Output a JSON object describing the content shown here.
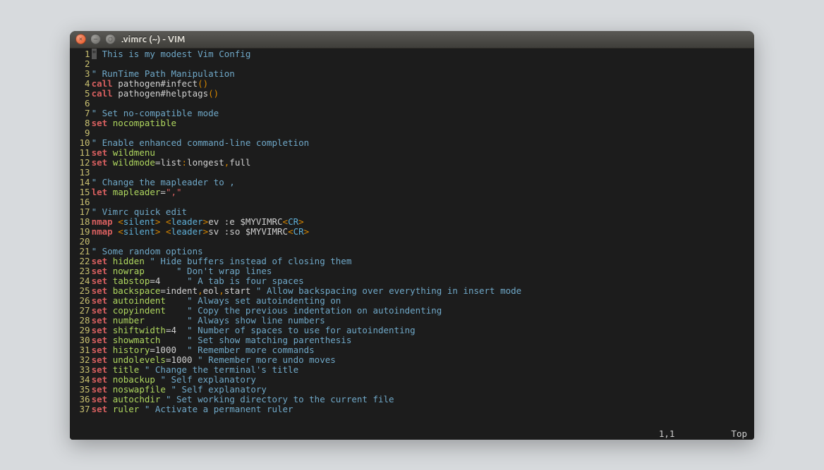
{
  "window": {
    "title": ".vimrc (~) - VIM"
  },
  "status": {
    "pos": "1,1",
    "scroll": "Top"
  },
  "lines": [
    {
      "n": 1,
      "seg": [
        {
          "t": "\""
        },
        {
          "t": " This is my modest Vim Config",
          "c": "c-comment"
        }
      ],
      "cursor_first": true
    },
    {
      "n": 2,
      "seg": []
    },
    {
      "n": 3,
      "seg": [
        {
          "t": "\" RunTime Path Manipulation",
          "c": "c-comment"
        }
      ]
    },
    {
      "n": 4,
      "seg": [
        {
          "t": "call",
          "c": "c-call"
        },
        {
          "t": " "
        },
        {
          "t": "pathogen#infect",
          "c": "c-func"
        },
        {
          "t": "()",
          "c": "c-paren"
        }
      ]
    },
    {
      "n": 5,
      "seg": [
        {
          "t": "call",
          "c": "c-call"
        },
        {
          "t": " "
        },
        {
          "t": "pathogen#helptags",
          "c": "c-func"
        },
        {
          "t": "()",
          "c": "c-paren"
        }
      ]
    },
    {
      "n": 6,
      "seg": []
    },
    {
      "n": 7,
      "seg": [
        {
          "t": "\" Set no-compatible mode",
          "c": "c-comment"
        }
      ]
    },
    {
      "n": 8,
      "seg": [
        {
          "t": "set",
          "c": "c-set"
        },
        {
          "t": " "
        },
        {
          "t": "nocompatible",
          "c": "c-opt"
        }
      ]
    },
    {
      "n": 9,
      "seg": []
    },
    {
      "n": 10,
      "seg": [
        {
          "t": "\" Enable enhanced command-line completion",
          "c": "c-comment"
        }
      ]
    },
    {
      "n": 11,
      "seg": [
        {
          "t": "set",
          "c": "c-set"
        },
        {
          "t": " "
        },
        {
          "t": "wildmenu",
          "c": "c-opt"
        }
      ]
    },
    {
      "n": 12,
      "seg": [
        {
          "t": "set",
          "c": "c-set"
        },
        {
          "t": " "
        },
        {
          "t": "wildmode",
          "c": "c-opt"
        },
        {
          "t": "="
        },
        {
          "t": "list"
        },
        {
          "t": ":",
          "c": "c-punct"
        },
        {
          "t": "longest"
        },
        {
          "t": ",",
          "c": "c-punct"
        },
        {
          "t": "full"
        }
      ]
    },
    {
      "n": 13,
      "seg": []
    },
    {
      "n": 14,
      "seg": [
        {
          "t": "\" Change the mapleader to ,",
          "c": "c-comment"
        }
      ]
    },
    {
      "n": 15,
      "seg": [
        {
          "t": "let",
          "c": "c-let"
        },
        {
          "t": " "
        },
        {
          "t": "mapleader",
          "c": "c-opt"
        },
        {
          "t": "="
        },
        {
          "t": "\",\"",
          "c": "c-str"
        }
      ]
    },
    {
      "n": 16,
      "seg": []
    },
    {
      "n": 17,
      "seg": [
        {
          "t": "\" Vimrc quick edit",
          "c": "c-comment"
        }
      ]
    },
    {
      "n": 18,
      "seg": [
        {
          "t": "nmap",
          "c": "c-nmap"
        },
        {
          "t": " "
        },
        {
          "t": "<",
          "c": "c-angle"
        },
        {
          "t": "silent",
          "c": "c-special"
        },
        {
          "t": ">",
          "c": "c-angle"
        },
        {
          "t": " "
        },
        {
          "t": "<",
          "c": "c-angle"
        },
        {
          "t": "leader",
          "c": "c-special"
        },
        {
          "t": ">",
          "c": "c-angle"
        },
        {
          "t": "ev :e $MYVIMRC"
        },
        {
          "t": "<",
          "c": "c-angle"
        },
        {
          "t": "CR",
          "c": "c-special"
        },
        {
          "t": ">",
          "c": "c-angle"
        }
      ]
    },
    {
      "n": 19,
      "seg": [
        {
          "t": "nmap",
          "c": "c-nmap"
        },
        {
          "t": " "
        },
        {
          "t": "<",
          "c": "c-angle"
        },
        {
          "t": "silent",
          "c": "c-special"
        },
        {
          "t": ">",
          "c": "c-angle"
        },
        {
          "t": " "
        },
        {
          "t": "<",
          "c": "c-angle"
        },
        {
          "t": "leader",
          "c": "c-special"
        },
        {
          "t": ">",
          "c": "c-angle"
        },
        {
          "t": "sv :so $MYVIMRC"
        },
        {
          "t": "<",
          "c": "c-angle"
        },
        {
          "t": "CR",
          "c": "c-special"
        },
        {
          "t": ">",
          "c": "c-angle"
        }
      ]
    },
    {
      "n": 20,
      "seg": []
    },
    {
      "n": 21,
      "seg": [
        {
          "t": "\" Some random options",
          "c": "c-comment"
        }
      ]
    },
    {
      "n": 22,
      "seg": [
        {
          "t": "set",
          "c": "c-set"
        },
        {
          "t": " "
        },
        {
          "t": "hidden",
          "c": "c-opt"
        },
        {
          "t": " "
        },
        {
          "t": "\" Hide buffers instead of closing them",
          "c": "c-comment"
        }
      ]
    },
    {
      "n": 23,
      "seg": [
        {
          "t": "set",
          "c": "c-set"
        },
        {
          "t": " "
        },
        {
          "t": "nowrap",
          "c": "c-opt"
        },
        {
          "t": "      "
        },
        {
          "t": "\" Don't wrap lines",
          "c": "c-comment"
        }
      ]
    },
    {
      "n": 24,
      "seg": [
        {
          "t": "set",
          "c": "c-set"
        },
        {
          "t": " "
        },
        {
          "t": "tabstop",
          "c": "c-opt"
        },
        {
          "t": "=4     "
        },
        {
          "t": "\" A tab is four spaces",
          "c": "c-comment"
        }
      ]
    },
    {
      "n": 25,
      "seg": [
        {
          "t": "set",
          "c": "c-set"
        },
        {
          "t": " "
        },
        {
          "t": "backspace",
          "c": "c-opt"
        },
        {
          "t": "="
        },
        {
          "t": "indent"
        },
        {
          "t": ",",
          "c": "c-punct"
        },
        {
          "t": "eol"
        },
        {
          "t": ",",
          "c": "c-punct"
        },
        {
          "t": "start"
        },
        {
          "t": " "
        },
        {
          "t": "\" Allow backspacing over everything in insert mode",
          "c": "c-comment"
        }
      ]
    },
    {
      "n": 26,
      "seg": [
        {
          "t": "set",
          "c": "c-set"
        },
        {
          "t": " "
        },
        {
          "t": "autoindent",
          "c": "c-opt"
        },
        {
          "t": "    "
        },
        {
          "t": "\" Always set autoindenting on",
          "c": "c-comment"
        }
      ]
    },
    {
      "n": 27,
      "seg": [
        {
          "t": "set",
          "c": "c-set"
        },
        {
          "t": " "
        },
        {
          "t": "copyindent",
          "c": "c-opt"
        },
        {
          "t": "    "
        },
        {
          "t": "\" Copy the previous indentation on autoindenting",
          "c": "c-comment"
        }
      ]
    },
    {
      "n": 28,
      "seg": [
        {
          "t": "set",
          "c": "c-set"
        },
        {
          "t": " "
        },
        {
          "t": "number",
          "c": "c-opt"
        },
        {
          "t": "        "
        },
        {
          "t": "\" Always show line numbers",
          "c": "c-comment"
        }
      ]
    },
    {
      "n": 29,
      "seg": [
        {
          "t": "set",
          "c": "c-set"
        },
        {
          "t": " "
        },
        {
          "t": "shiftwidth",
          "c": "c-opt"
        },
        {
          "t": "=4  "
        },
        {
          "t": "\" Number of spaces to use for autoindenting",
          "c": "c-comment"
        }
      ]
    },
    {
      "n": 30,
      "seg": [
        {
          "t": "set",
          "c": "c-set"
        },
        {
          "t": " "
        },
        {
          "t": "showmatch",
          "c": "c-opt"
        },
        {
          "t": "     "
        },
        {
          "t": "\" Set show matching parenthesis",
          "c": "c-comment"
        }
      ]
    },
    {
      "n": 31,
      "seg": [
        {
          "t": "set",
          "c": "c-set"
        },
        {
          "t": " "
        },
        {
          "t": "history",
          "c": "c-opt"
        },
        {
          "t": "=1000  "
        },
        {
          "t": "\" Remember more commands",
          "c": "c-comment"
        }
      ]
    },
    {
      "n": 32,
      "seg": [
        {
          "t": "set",
          "c": "c-set"
        },
        {
          "t": " "
        },
        {
          "t": "undolevels",
          "c": "c-opt"
        },
        {
          "t": "=1000 "
        },
        {
          "t": "\" Remember more undo moves",
          "c": "c-comment"
        }
      ]
    },
    {
      "n": 33,
      "seg": [
        {
          "t": "set",
          "c": "c-set"
        },
        {
          "t": " "
        },
        {
          "t": "title",
          "c": "c-opt"
        },
        {
          "t": " "
        },
        {
          "t": "\" Change the terminal's title",
          "c": "c-comment"
        }
      ]
    },
    {
      "n": 34,
      "seg": [
        {
          "t": "set",
          "c": "c-set"
        },
        {
          "t": " "
        },
        {
          "t": "nobackup",
          "c": "c-opt"
        },
        {
          "t": " "
        },
        {
          "t": "\" Self explanatory",
          "c": "c-comment"
        }
      ]
    },
    {
      "n": 35,
      "seg": [
        {
          "t": "set",
          "c": "c-set"
        },
        {
          "t": " "
        },
        {
          "t": "noswapfile",
          "c": "c-opt"
        },
        {
          "t": " "
        },
        {
          "t": "\" Self explanatory",
          "c": "c-comment"
        }
      ]
    },
    {
      "n": 36,
      "seg": [
        {
          "t": "set",
          "c": "c-set"
        },
        {
          "t": " "
        },
        {
          "t": "autochdir",
          "c": "c-opt"
        },
        {
          "t": " "
        },
        {
          "t": "\" Set working directory to the current file",
          "c": "c-comment"
        }
      ]
    },
    {
      "n": 37,
      "seg": [
        {
          "t": "set",
          "c": "c-set"
        },
        {
          "t": " "
        },
        {
          "t": "ruler",
          "c": "c-opt"
        },
        {
          "t": " "
        },
        {
          "t": "\" Activate a permanent ruler",
          "c": "c-comment"
        }
      ]
    }
  ]
}
